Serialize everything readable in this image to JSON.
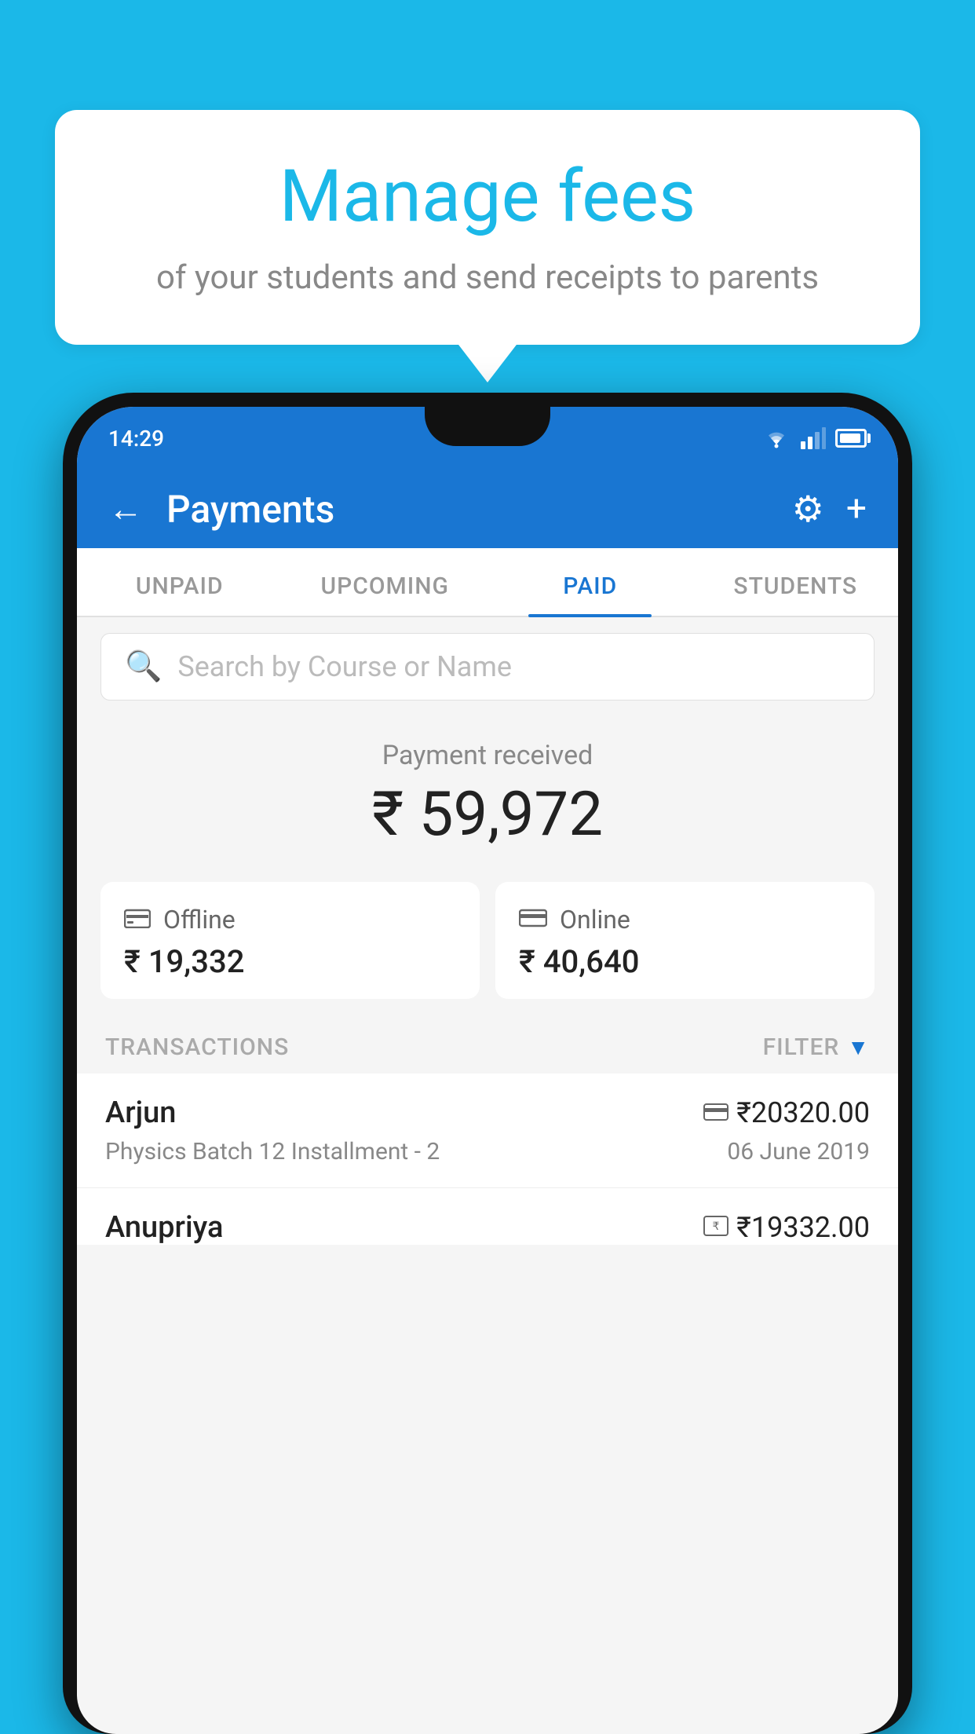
{
  "background_color": "#1BB8E8",
  "speech_bubble": {
    "title": "Manage fees",
    "subtitle": "of your students and send receipts to parents"
  },
  "status_bar": {
    "time": "14:29"
  },
  "app_header": {
    "title": "Payments",
    "back_label": "←",
    "settings_label": "⚙",
    "add_label": "+"
  },
  "tabs": [
    {
      "label": "UNPAID",
      "active": false
    },
    {
      "label": "UPCOMING",
      "active": false
    },
    {
      "label": "PAID",
      "active": true
    },
    {
      "label": "STUDENTS",
      "active": false
    }
  ],
  "search": {
    "placeholder": "Search by Course or Name"
  },
  "payment_summary": {
    "label": "Payment received",
    "amount": "₹ 59,972"
  },
  "payment_cards": [
    {
      "icon": "₹",
      "label": "Offline",
      "amount": "₹ 19,332"
    },
    {
      "icon": "▬",
      "label": "Online",
      "amount": "₹ 40,640"
    }
  ],
  "transactions_section": {
    "label": "TRANSACTIONS",
    "filter_label": "FILTER"
  },
  "transactions": [
    {
      "name": "Arjun",
      "icon": "card",
      "amount": "₹20320.00",
      "course": "Physics Batch 12 Installment - 2",
      "date": "06 June 2019"
    },
    {
      "name": "Anupriya",
      "icon": "cash",
      "amount": "₹19332.00",
      "course": "",
      "date": ""
    }
  ]
}
